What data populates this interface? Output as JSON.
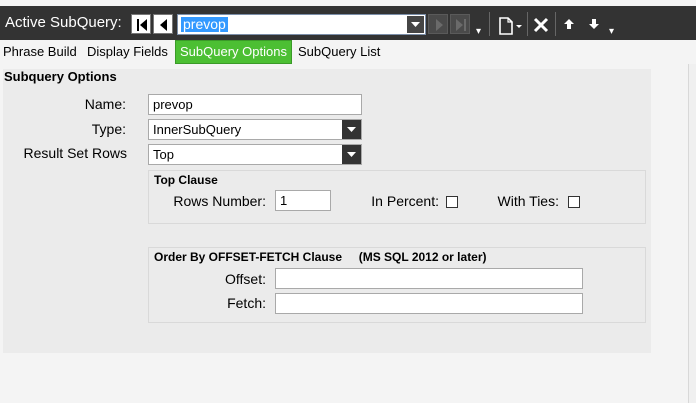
{
  "toolbar": {
    "active_label": "Active SubQuery:",
    "selected_subquery": "prevop",
    "icons": [
      "first-icon",
      "previous-icon",
      "next-icon",
      "last-icon",
      "new-icon",
      "delete-icon",
      "move-up-icon",
      "move-down-icon"
    ]
  },
  "tabs": [
    {
      "label": "Phrase Build",
      "active": false
    },
    {
      "label": "Display Fields",
      "active": false
    },
    {
      "label": "SubQuery Options",
      "active": true
    },
    {
      "label": "SubQuery List",
      "active": false
    }
  ],
  "colors": {
    "toolbar_bg": "#333333",
    "active_tab": "#4cbf33",
    "selection": "#3399ff"
  },
  "options": {
    "section_title": "Subquery Options",
    "name_label": "Name:",
    "name_value": "prevop",
    "type_label": "Type:",
    "type_value": "InnerSubQuery",
    "rows_label": "Result Set Rows",
    "rows_value": "Top"
  },
  "top_clause": {
    "title": "Top Clause",
    "rows_number_label": "Rows Number:",
    "rows_number_value": "1",
    "in_percent_label": "In Percent:",
    "in_percent_checked": false,
    "with_ties_label": "With Ties:",
    "with_ties_checked": false
  },
  "order_by": {
    "title": "Order By OFFSET-FETCH Clause     (MS SQL 2012 or later)",
    "offset_label": "Offset:",
    "offset_value": "",
    "fetch_label": "Fetch:",
    "fetch_value": ""
  }
}
